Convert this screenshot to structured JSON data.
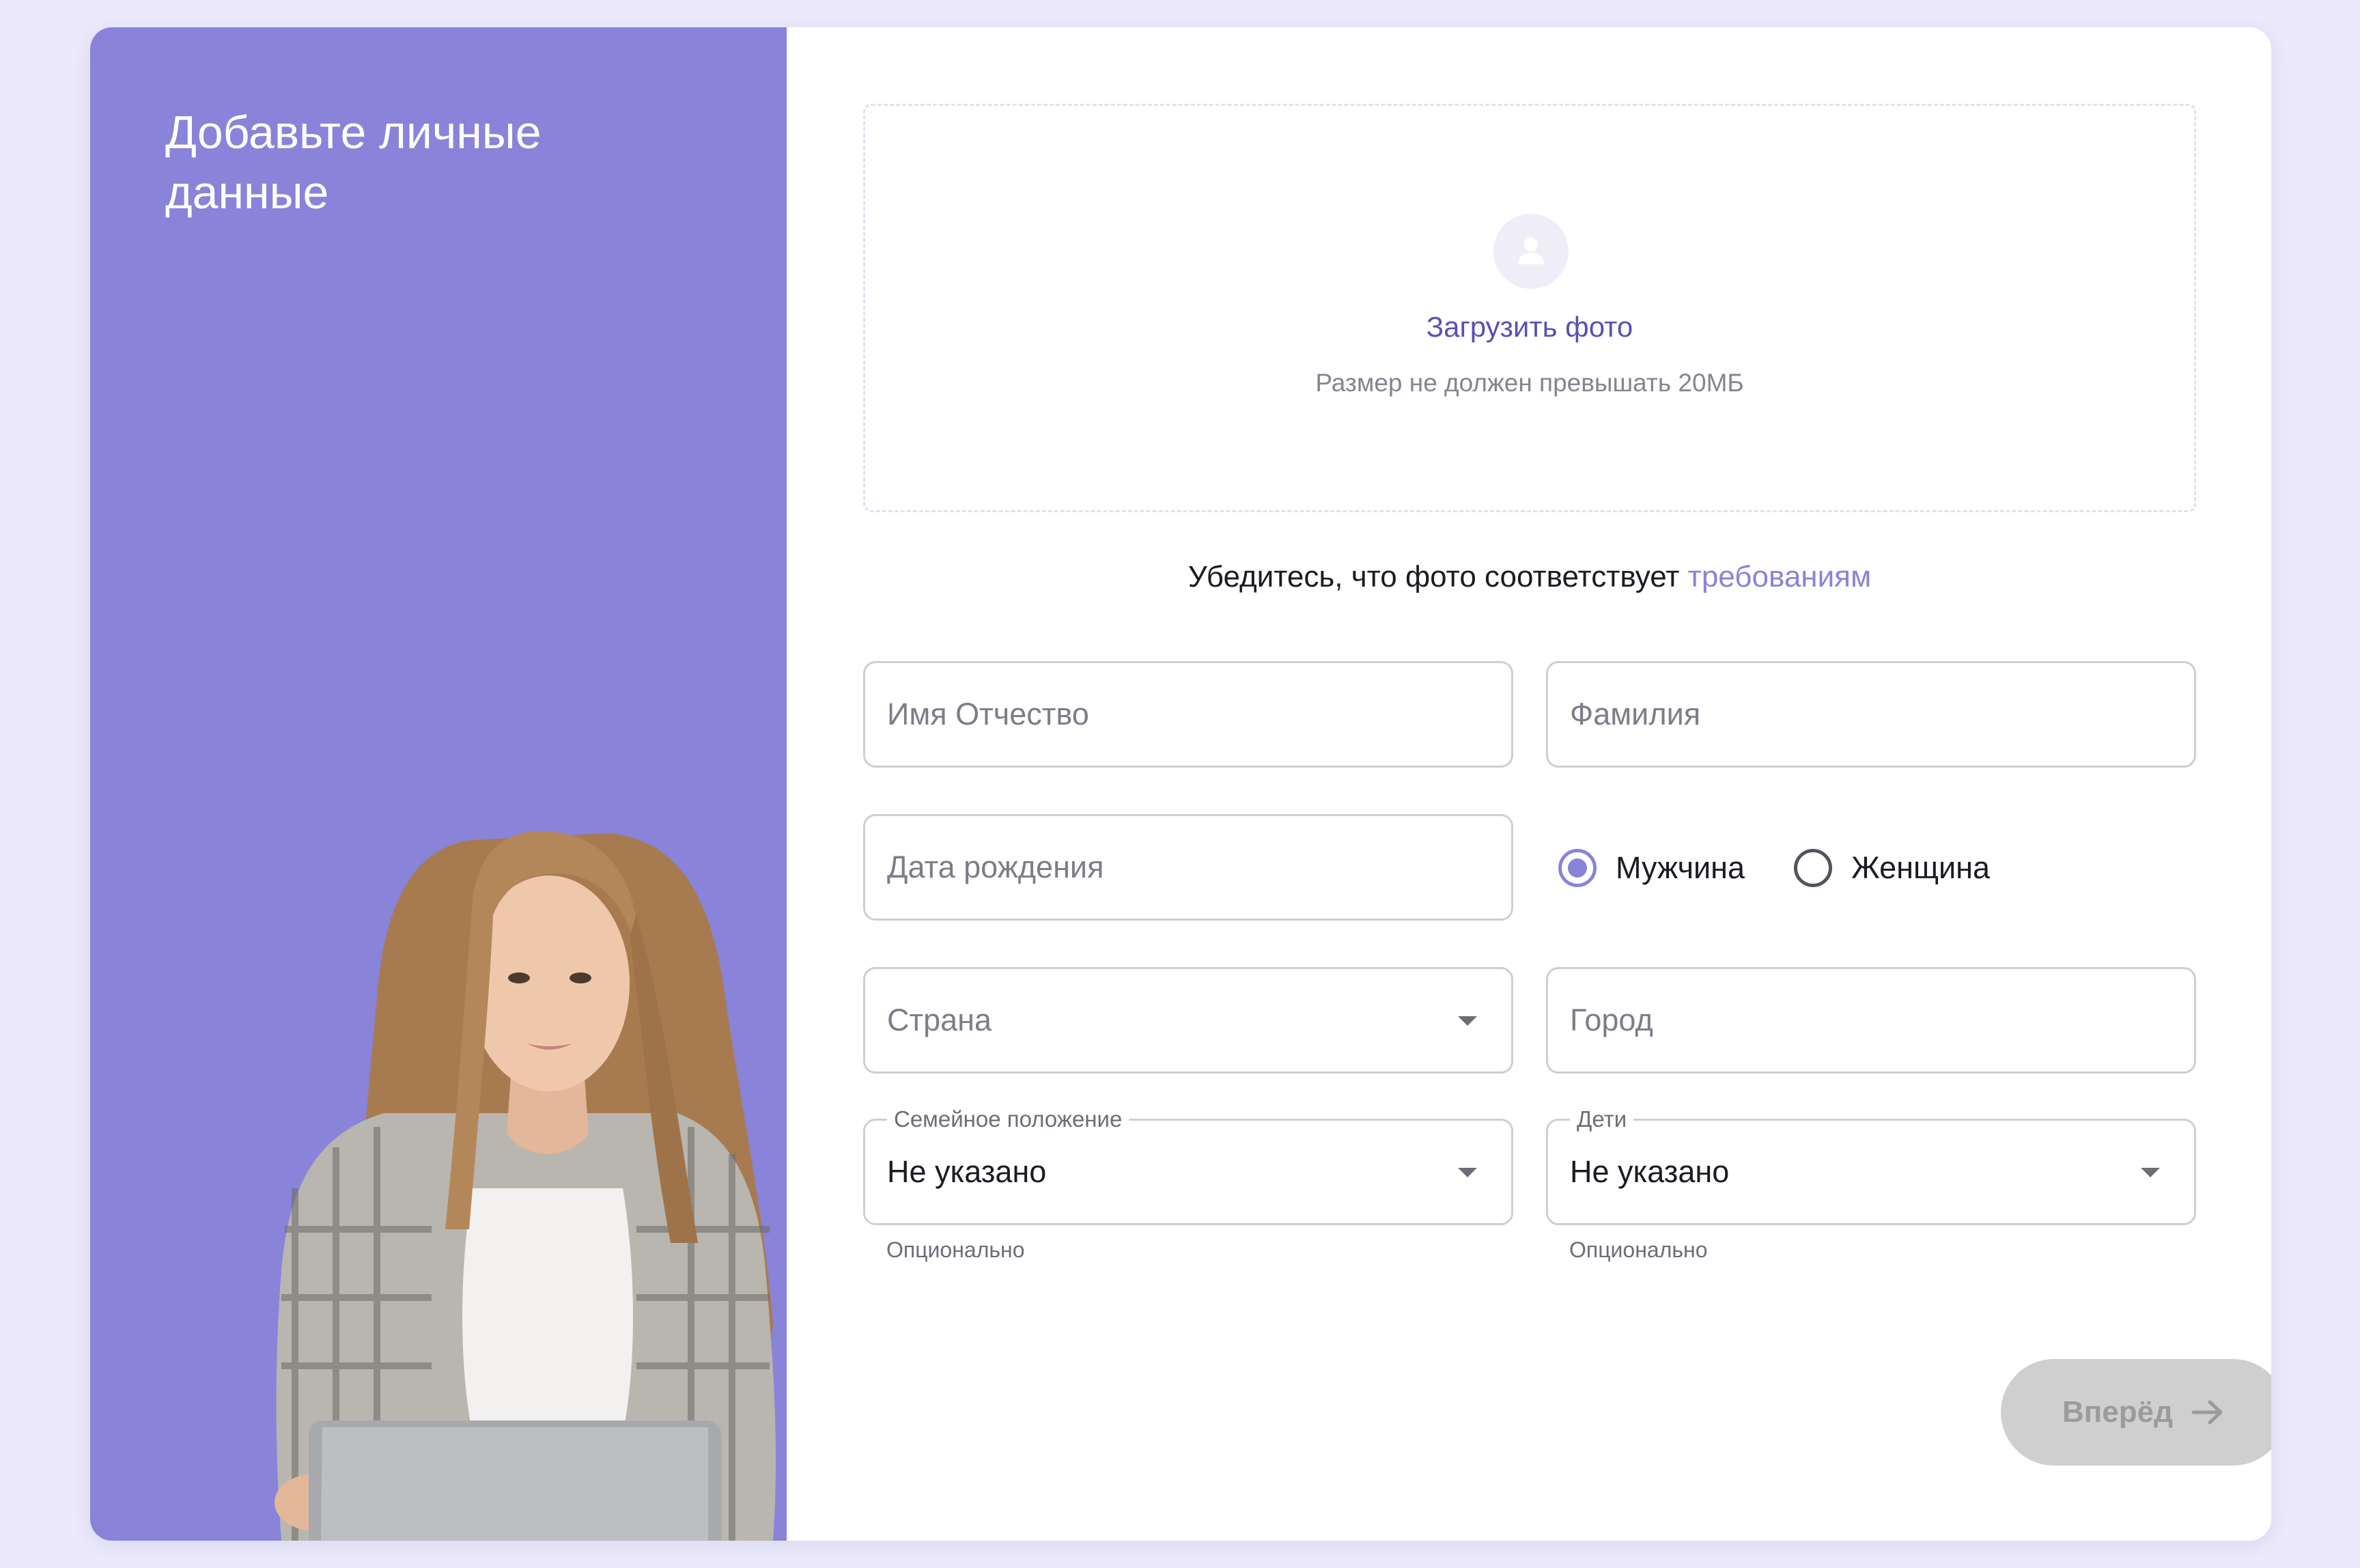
{
  "left_panel": {
    "title": "Добавьте личные данные"
  },
  "upload": {
    "link_label": "Загрузить фото",
    "hint": "Размер не должен превышать 20МБ",
    "icon": "user-avatar-icon"
  },
  "requirements": {
    "text": "Убедитесь, что фото соответствует ",
    "link": "требованиям"
  },
  "form": {
    "first_name": {
      "placeholder": "Имя Отчество",
      "value": ""
    },
    "last_name": {
      "placeholder": "Фамилия",
      "value": ""
    },
    "birth_date": {
      "placeholder": "Дата рождения",
      "value": ""
    },
    "gender": {
      "options": [
        "Мужчина",
        "Женщина"
      ],
      "selected": "Мужчина"
    },
    "country": {
      "placeholder": "Страна",
      "value": ""
    },
    "city": {
      "placeholder": "Город",
      "value": ""
    },
    "marital_status": {
      "label": "Семейное положение",
      "value": "Не указано",
      "helper": "Опционально"
    },
    "children": {
      "label": "Дети",
      "value": "Не указано",
      "helper": "Опционально"
    }
  },
  "next_button": {
    "label": "Вперёд",
    "state": "disabled"
  },
  "colors": {
    "background": "#ebe9fa",
    "panel": "#8983d9",
    "link": "#5a4fb5",
    "button_disabled": "#cfcfcf"
  }
}
